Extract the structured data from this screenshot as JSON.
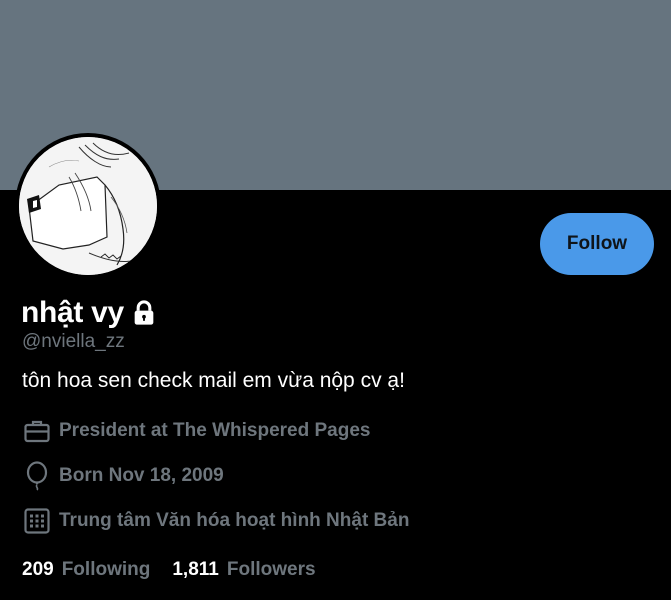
{
  "profile": {
    "display_name": "nhật vy",
    "handle": "@nviella_zz",
    "bio": "tôn hoa sen check mail em vừa nộp cv ạ!",
    "job": "President at The Whispered Pages",
    "birth": "Born Nov 18, 2009",
    "location": "Trung tâm Văn hóa hoạt hình Nhật Bản",
    "avatar_description": "line-art sketch avatar",
    "banner_color": "#66747f"
  },
  "actions": {
    "follow_label": "Follow",
    "follow_color": "#4a99e9"
  },
  "stats": {
    "following_count": "209",
    "following_label": "Following",
    "followers_count": "1,811",
    "followers_label": "Followers"
  },
  "icons": {
    "lock": "lock-icon",
    "job": "briefcase-icon",
    "birth": "balloon-icon",
    "location": "calendar-grid-icon"
  }
}
